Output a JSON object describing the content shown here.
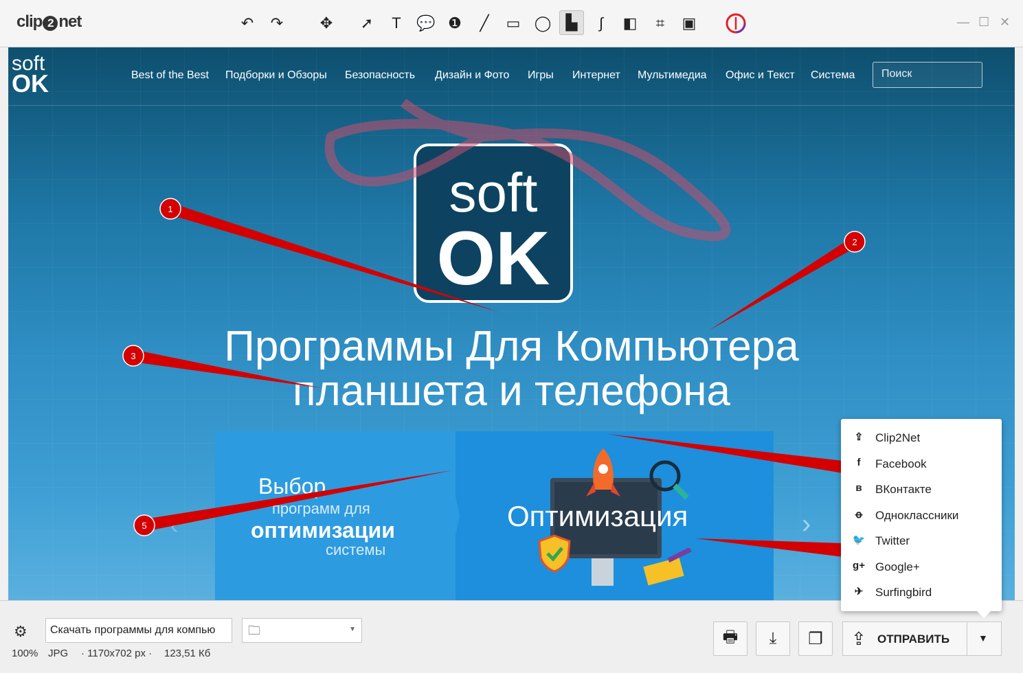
{
  "app": {
    "logo_pre": "clip",
    "logo_num": "2",
    "logo_post": "net"
  },
  "toolbar": {
    "tools": [
      {
        "name": "undo-icon",
        "glyph": "↶"
      },
      {
        "name": "redo-icon",
        "glyph": "↷"
      },
      {
        "name": "move-icon",
        "glyph": "✥"
      },
      {
        "name": "arrow-tool-icon",
        "glyph": "➚"
      },
      {
        "name": "text-tool-icon",
        "glyph": "T"
      },
      {
        "name": "callout-tool-icon",
        "glyph": "💬"
      },
      {
        "name": "marker-number-icon",
        "glyph": "❶"
      },
      {
        "name": "line-tool-icon",
        "glyph": "╱"
      },
      {
        "name": "rectangle-tool-icon",
        "glyph": "▭"
      },
      {
        "name": "ellipse-tool-icon",
        "glyph": "◯"
      },
      {
        "name": "highlighter-tool-icon",
        "glyph": "▙"
      },
      {
        "name": "freehand-tool-icon",
        "glyph": "∫"
      },
      {
        "name": "blur-tool-icon",
        "glyph": "◧"
      },
      {
        "name": "crop-tool-icon",
        "glyph": "⌗"
      },
      {
        "name": "resize-tool-icon",
        "glyph": "▣"
      }
    ],
    "active_tool": "highlighter-tool-icon"
  },
  "window": {
    "minimize": "—",
    "maximize": "☐",
    "close": "✕"
  },
  "site": {
    "logo_soft": "soft",
    "logo_ok": "OK",
    "nav": [
      "Best of the Best",
      "Подборки и Обзоры",
      "Безопасность",
      "Дизайн и Фото",
      "Игры",
      "Интернет",
      "Мультимедиа",
      "Офис и Текст",
      "Система"
    ],
    "search_placeholder": "Поиск",
    "big_soft": "soft",
    "big_ok": "OK",
    "headline_1": "Программы Для Компьютера",
    "headline_2": "планшета и телефона",
    "banner_t1": "Выбор",
    "banner_t2": "программ для",
    "banner_t3": "оптимизации",
    "banner_t4": "системы",
    "banner_t5": "Оптимизация"
  },
  "annotations": {
    "markers": [
      "1",
      "2",
      "3",
      "5"
    ],
    "marker_color": "#d40000"
  },
  "share_menu": {
    "items": [
      {
        "icon": "upload-icon",
        "glyph": "⇪",
        "label": "Clip2Net"
      },
      {
        "icon": "facebook-icon",
        "glyph": "f",
        "label": "Facebook"
      },
      {
        "icon": "vk-icon",
        "glyph": "в",
        "label": "ВКонтакте"
      },
      {
        "icon": "odnoklassniki-icon",
        "glyph": "ꝋ",
        "label": "Одноклассники"
      },
      {
        "icon": "twitter-icon",
        "glyph": "🐦",
        "label": "Twitter"
      },
      {
        "icon": "googleplus-icon",
        "glyph": "g+",
        "label": "Google+"
      },
      {
        "icon": "surfingbird-icon",
        "glyph": "✈",
        "label": "Surfingbird"
      }
    ]
  },
  "bottom": {
    "filename": "Скачать программы для компью",
    "zoom": "100%",
    "format": "JPG",
    "dimensions": "· 1170x702 px ·",
    "size": "123,51 Кб",
    "send_label": "ОТПРАВИТЬ"
  }
}
